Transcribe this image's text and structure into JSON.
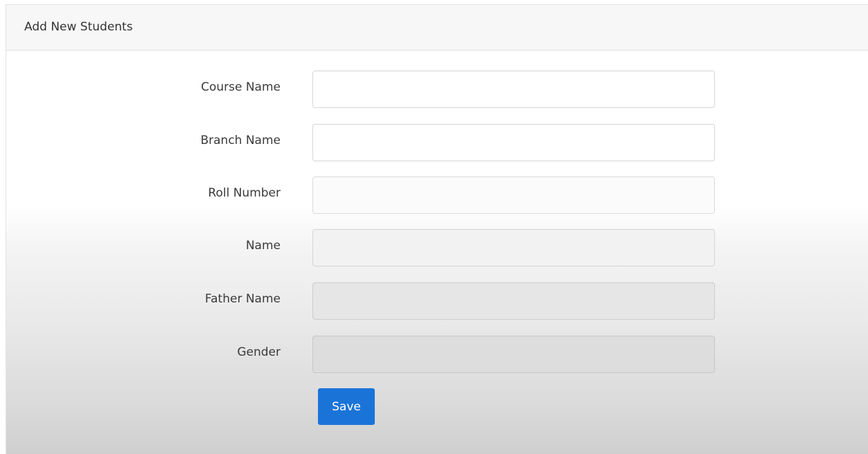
{
  "card": {
    "title": "Add New Students"
  },
  "form": {
    "fields": [
      {
        "label": "Course Name",
        "value": ""
      },
      {
        "label": "Branch Name",
        "value": ""
      },
      {
        "label": "Roll Number",
        "value": ""
      },
      {
        "label": "Name",
        "value": ""
      },
      {
        "label": "Father Name",
        "value": ""
      },
      {
        "label": "Gender",
        "value": ""
      }
    ],
    "save_label": "Save"
  },
  "colors": {
    "primary_button": "#1a74d8",
    "header_background": "#f7f7f7"
  }
}
